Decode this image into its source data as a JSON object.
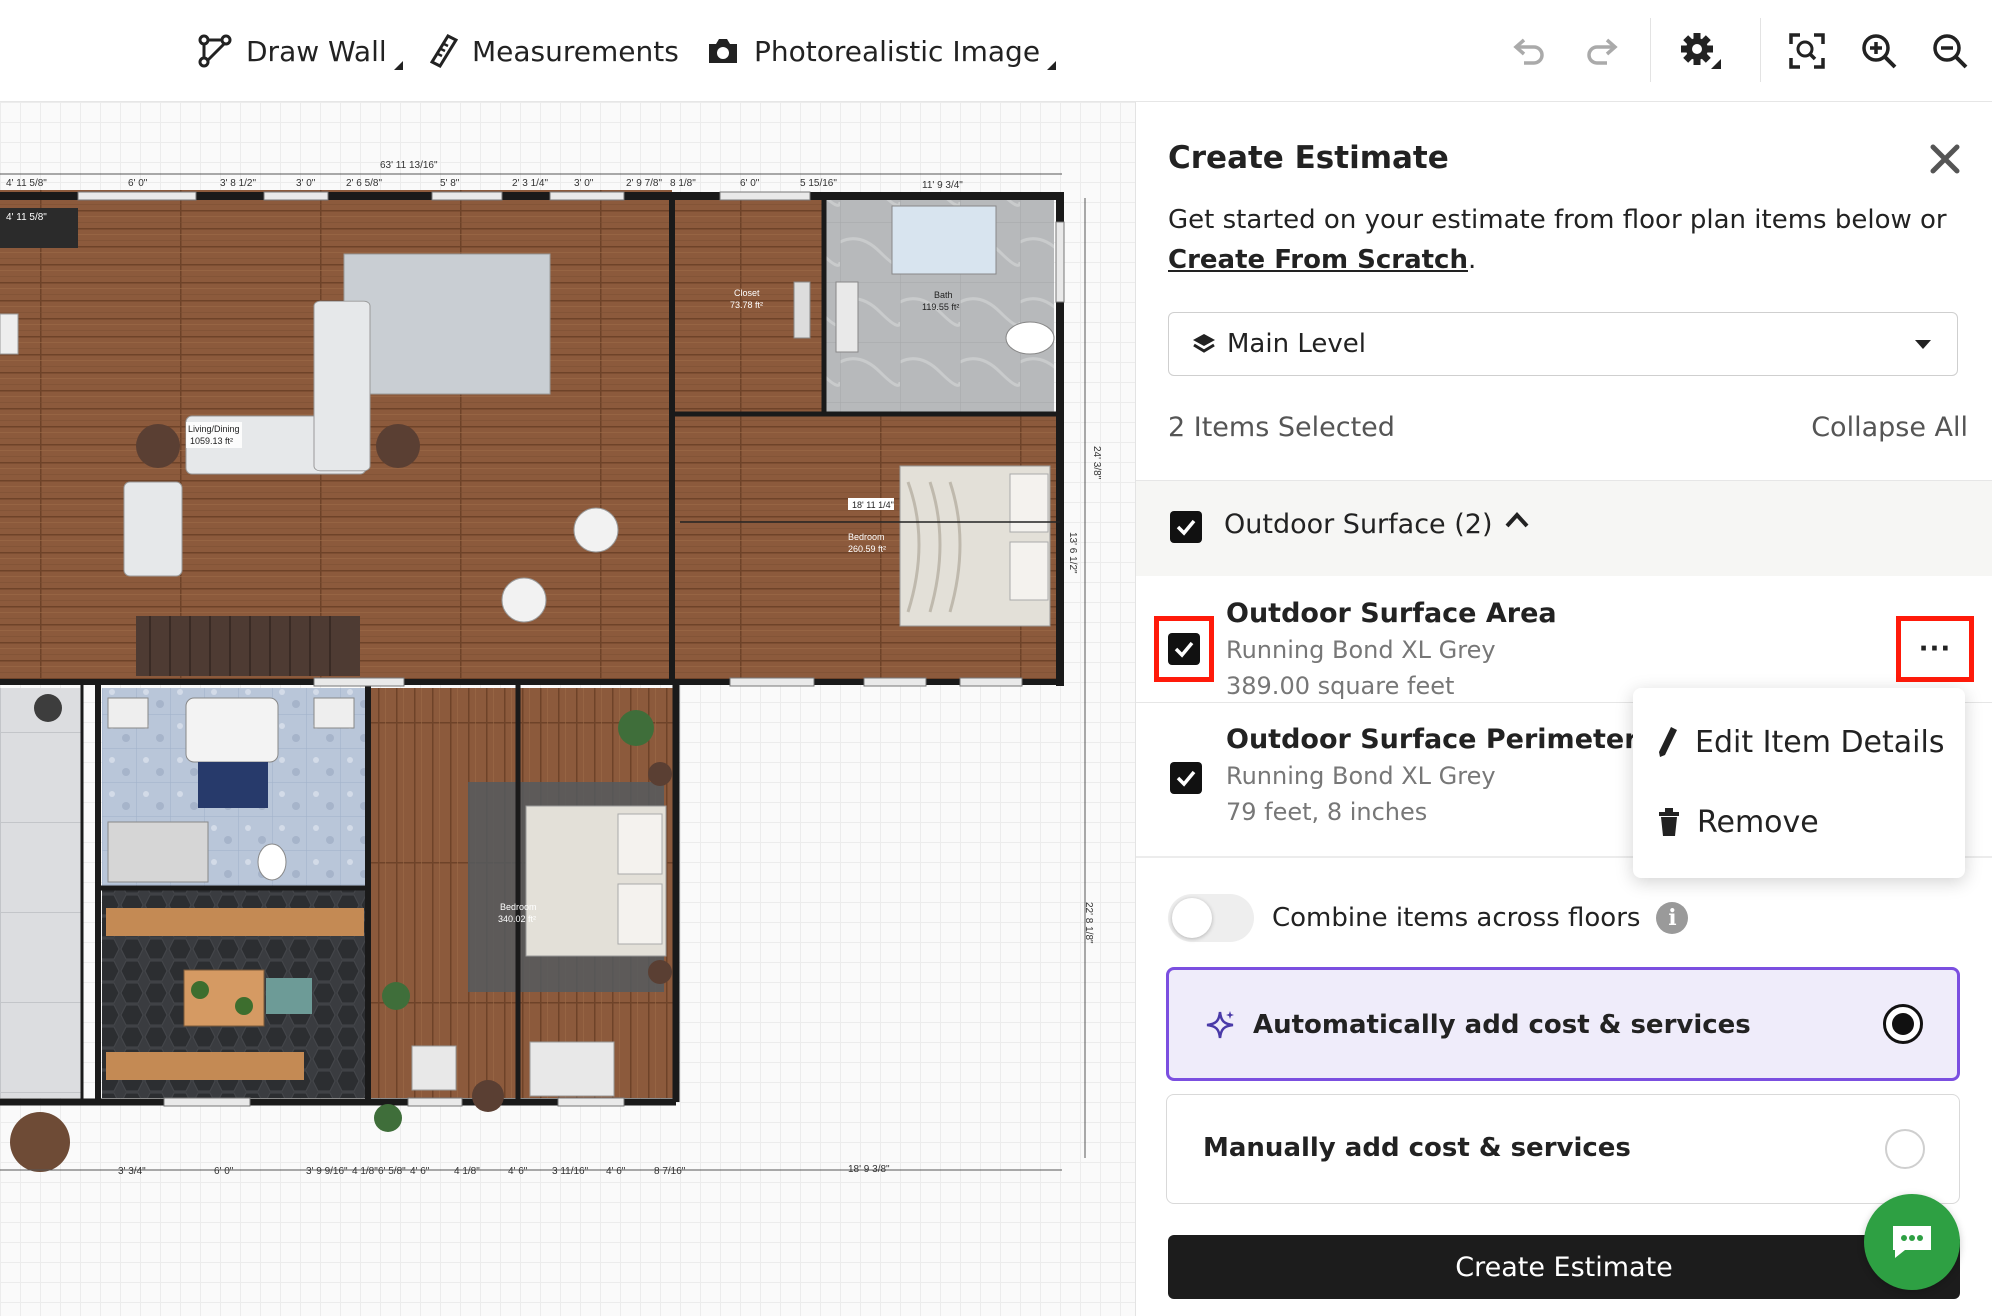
{
  "toolbar": {
    "draw_wall": "Draw Wall",
    "measurements": "Measurements",
    "photoreal": "Photorealistic Image",
    "icons": [
      "undo-icon",
      "redo-icon",
      "gear-icon",
      "fit-view-icon",
      "zoom-in-icon",
      "zoom-out-icon"
    ]
  },
  "floorplan": {
    "labels": {
      "top_total": "63' 11 13/16\"",
      "living_name": "Living/Dining",
      "living_area": "1059.13 ft²",
      "closet_name": "Closet",
      "closet_area": "73.78 ft²",
      "bath_name": "Bath",
      "bath_area": "119.55 ft²",
      "bedroom1_name": "Bedroom",
      "bedroom1_area": "260.59 ft²",
      "bedroom2_name": "Bedroom",
      "bedroom2_area": "340.02 ft²",
      "bed_width": "18' 11 1/4\"",
      "right_dim_1": "24' 3/8\"",
      "right_dim_2": "13' 6 1/2\"",
      "right_dim_3": "22' 8 1/8\"",
      "bottom_dim": "18' 9 3/8\"",
      "tv_label": "4' 11 5/8\""
    },
    "dims_top": [
      "4' 11 5/8\"",
      "6' 0\"",
      "3' 8 1/2\"",
      "3' 0\"",
      "2' 6 5/8\"",
      "5' 8\"",
      "2' 3 1/4\"",
      "3' 0\"",
      "2' 9 7/8\"",
      "8 1/8\"",
      "6' 0\"",
      "5 15/16\"",
      "11' 9 3/4\""
    ],
    "dims_bottom": [
      "3' 3/4\"",
      "6' 0\"",
      "3' 9 9/16\"",
      "4 1/8\"",
      "6' 5/8\"",
      "4' 6\"",
      "4 1/8\"",
      "4' 6\"",
      "3 11/16\"",
      "4' 6\"",
      "8 7/16\""
    ]
  },
  "panel": {
    "title": "Create Estimate",
    "desc_prefix": "Get started on your estimate from floor plan items below or",
    "desc_link": "Create From Scratch",
    "desc_suffix": ".",
    "level": "Main Level",
    "items_selected": "2 Items Selected",
    "collapse_all": "Collapse All",
    "group_label": "Outdoor Surface (2)",
    "items": [
      {
        "title": "Outdoor Surface Area",
        "material": "Running Bond XL Grey",
        "size": "389.00 square feet"
      },
      {
        "title": "Outdoor Surface Perimeter",
        "material": "Running Bond XL Grey",
        "size": "79 feet, 8 inches"
      }
    ],
    "menu": {
      "edit": "Edit Item Details",
      "remove": "Remove"
    },
    "combine_label": "Combine items across floors",
    "auto_label": "Automatically add cost & services",
    "manual_label": "Manually add cost & services",
    "create_button": "Create Estimate",
    "colors": {
      "accent": "#7b4fe0",
      "chat": "#2ea043",
      "highlight": "#ff1a0a"
    }
  }
}
